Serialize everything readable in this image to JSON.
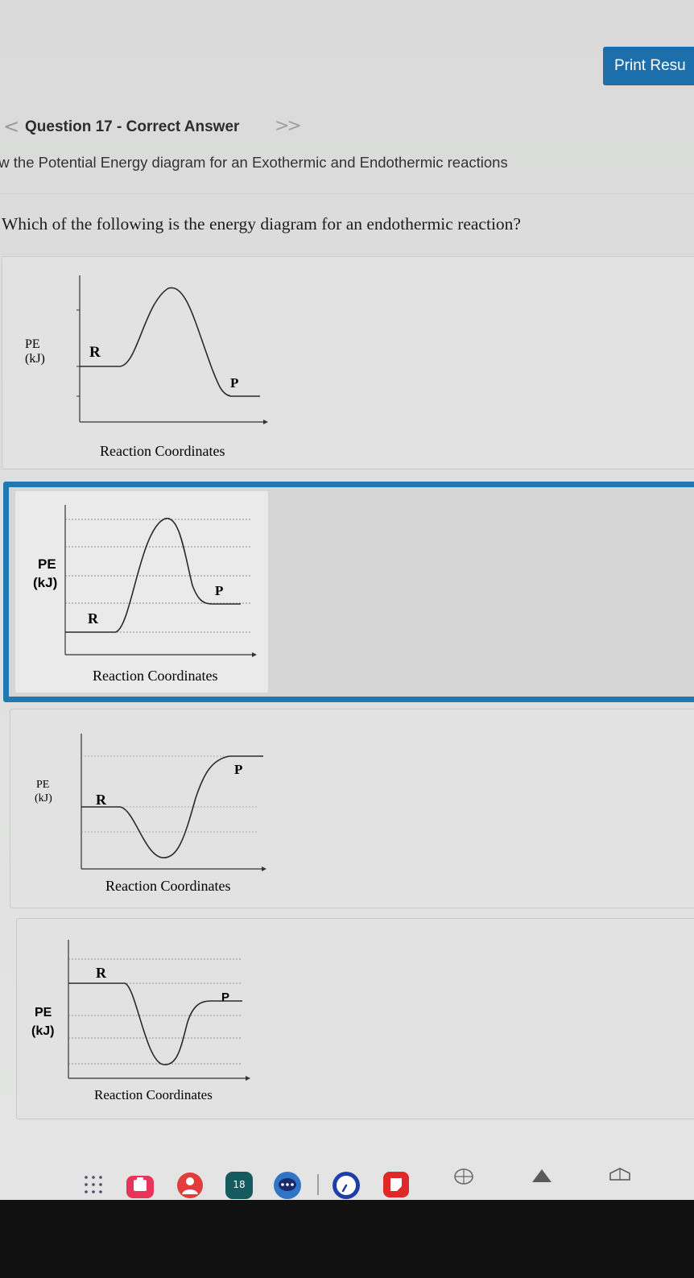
{
  "toolbar": {
    "print_label": "Print Resu"
  },
  "nav": {
    "prev_symbol": "<",
    "title": "Question 17 - Correct Answer",
    "next_symbol": ">>"
  },
  "section_subtitle": "ow the Potential Energy diagram for an Exothermic and Endothermic reactions",
  "question_text": "Which of the following is the energy diagram for an endothermic reaction?",
  "options": [
    {
      "pe": "PE",
      "unit": "(kJ)",
      "reactant": "R",
      "product": "P",
      "xaxis": "Reaction Coordinates"
    },
    {
      "pe": "PE",
      "unit": "(kJ)",
      "reactant": "R",
      "product": "P",
      "xaxis": "Reaction Coordinates"
    },
    {
      "pe": "PE",
      "unit": "(kJ)",
      "reactant": "R",
      "product": "P",
      "xaxis": "Reaction Coordinates"
    },
    {
      "pe": "PE",
      "unit": "(kJ)",
      "reactant": "R",
      "product": "P",
      "xaxis": "Reaction Coordinates"
    }
  ],
  "taskbar": {
    "calendar_day": "18",
    "icons": [
      "apps-grid-icon",
      "briefcase-icon",
      "account-icon",
      "calendar-icon",
      "chat-icon",
      "clock-icon",
      "keep-notes-icon",
      "network-icon",
      "wifi-icon",
      "battery-icon"
    ]
  }
}
